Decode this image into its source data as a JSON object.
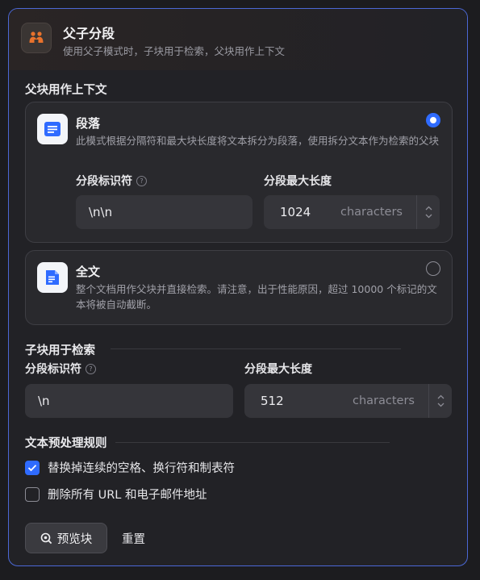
{
  "header": {
    "title": "父子分段",
    "subtitle": "使用父子模式时，子块用于检索，父块用作上下文",
    "icon": "parent-child-icon"
  },
  "parent_section": {
    "title": "父块用作上下文",
    "paragraph": {
      "title": "段落",
      "description": "此模式根据分隔符和最大块长度将文本拆分为段落，使用拆分文本作为检索的父块",
      "selected": true,
      "delimiter_label": "分段标识符",
      "delimiter_value": "\\n\\n",
      "maxlen_label": "分段最大长度",
      "maxlen_value": "1024",
      "maxlen_unit": "characters"
    },
    "fulltext": {
      "title": "全文",
      "description": "整个文档用作父块并直接检索。请注意，出于性能原因，超过 10000 个标记的文本将被自动截断。",
      "selected": false
    }
  },
  "child_section": {
    "title": "子块用于检索",
    "delimiter_label": "分段标识符",
    "delimiter_value": "\\n",
    "maxlen_label": "分段最大长度",
    "maxlen_value": "512",
    "maxlen_unit": "characters"
  },
  "preprocess": {
    "title": "文本预处理规则",
    "rules": [
      {
        "label": "替换掉连续的空格、换行符和制表符",
        "checked": true
      },
      {
        "label": "删除所有 URL 和电子邮件地址",
        "checked": false
      }
    ]
  },
  "actions": {
    "preview_label": "预览块",
    "reset_label": "重置"
  },
  "colors": {
    "accent": "#2f6bff",
    "panel_border": "#4b68d6",
    "header_icon": "#e8722c"
  }
}
